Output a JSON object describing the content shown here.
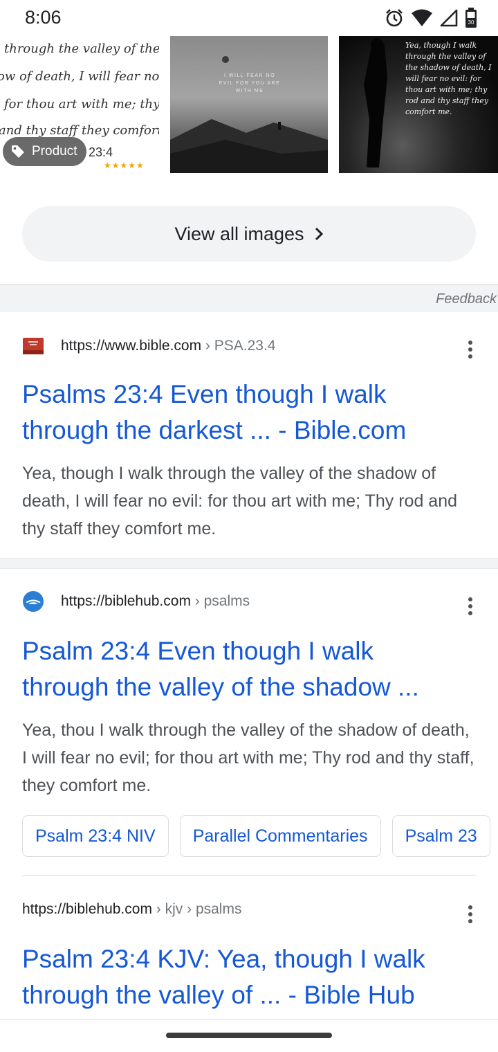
{
  "status_bar": {
    "time": "8:06",
    "icons": [
      "alarm-icon",
      "wifi-icon",
      "signal-icon",
      "battery-icon"
    ],
    "battery_level": "30"
  },
  "images": {
    "thumb1": {
      "lines": [
        "through the valley of the",
        "ow of death, I will fear no e",
        "for thou art with me; thy",
        "and thy staff they comfort m",
        "23:4"
      ],
      "stars": "★★★★★"
    },
    "product_chip": {
      "icon": "tag-icon",
      "label": "Product"
    },
    "thumb2": {
      "text": "I WILL FEAR NO EVIL FOR YOU ARE WITH ME"
    },
    "thumb3": {
      "text": "Yea, though I walk through the valley of the shadow of death, I will fear no evil: for thou art with me; thy rod and thy staff they comfort me."
    }
  },
  "view_all": {
    "label": "View all images",
    "icon": "chevron-right-icon"
  },
  "feedback": {
    "label": "Feedback"
  },
  "results": [
    {
      "favicon": "bible-app-icon",
      "url": "https://www.bible.com",
      "path": " › PSA.23.4",
      "title_line1": "Psalms 23:4 Even though I walk",
      "title_line2": "through the darkest ... - Bible.com",
      "snippet": "Yea, though I walk through the valley of the shadow of death, I will fear no evil: for thou art with me; Thy rod and thy staff they comfort me."
    },
    {
      "favicon": "biblehub-icon",
      "url": "https://biblehub.com",
      "path": " › psalms",
      "title_line1": "Psalm 23:4 Even though I walk",
      "title_line2": "through the valley of the shadow ...",
      "snippet": "Yea, thou I walk through the valley of the shadow of death, I will fear no evil; for thou art with me; Thy rod and thy staff, they comfort me.",
      "chips": [
        "Psalm 23:4 NIV",
        "Parallel Commentaries",
        "Psalm 23"
      ]
    },
    {
      "url": "https://biblehub.com",
      "path": " › kjv › psalms",
      "title_line1": "Psalm 23:4 KJV: Yea, though I walk",
      "title_line2": "through the valley of ... - Bible Hub"
    }
  ],
  "colors": {
    "link": "#1558d6",
    "snippet": "#4d5156",
    "chip_bg": "#f1f3f4"
  }
}
